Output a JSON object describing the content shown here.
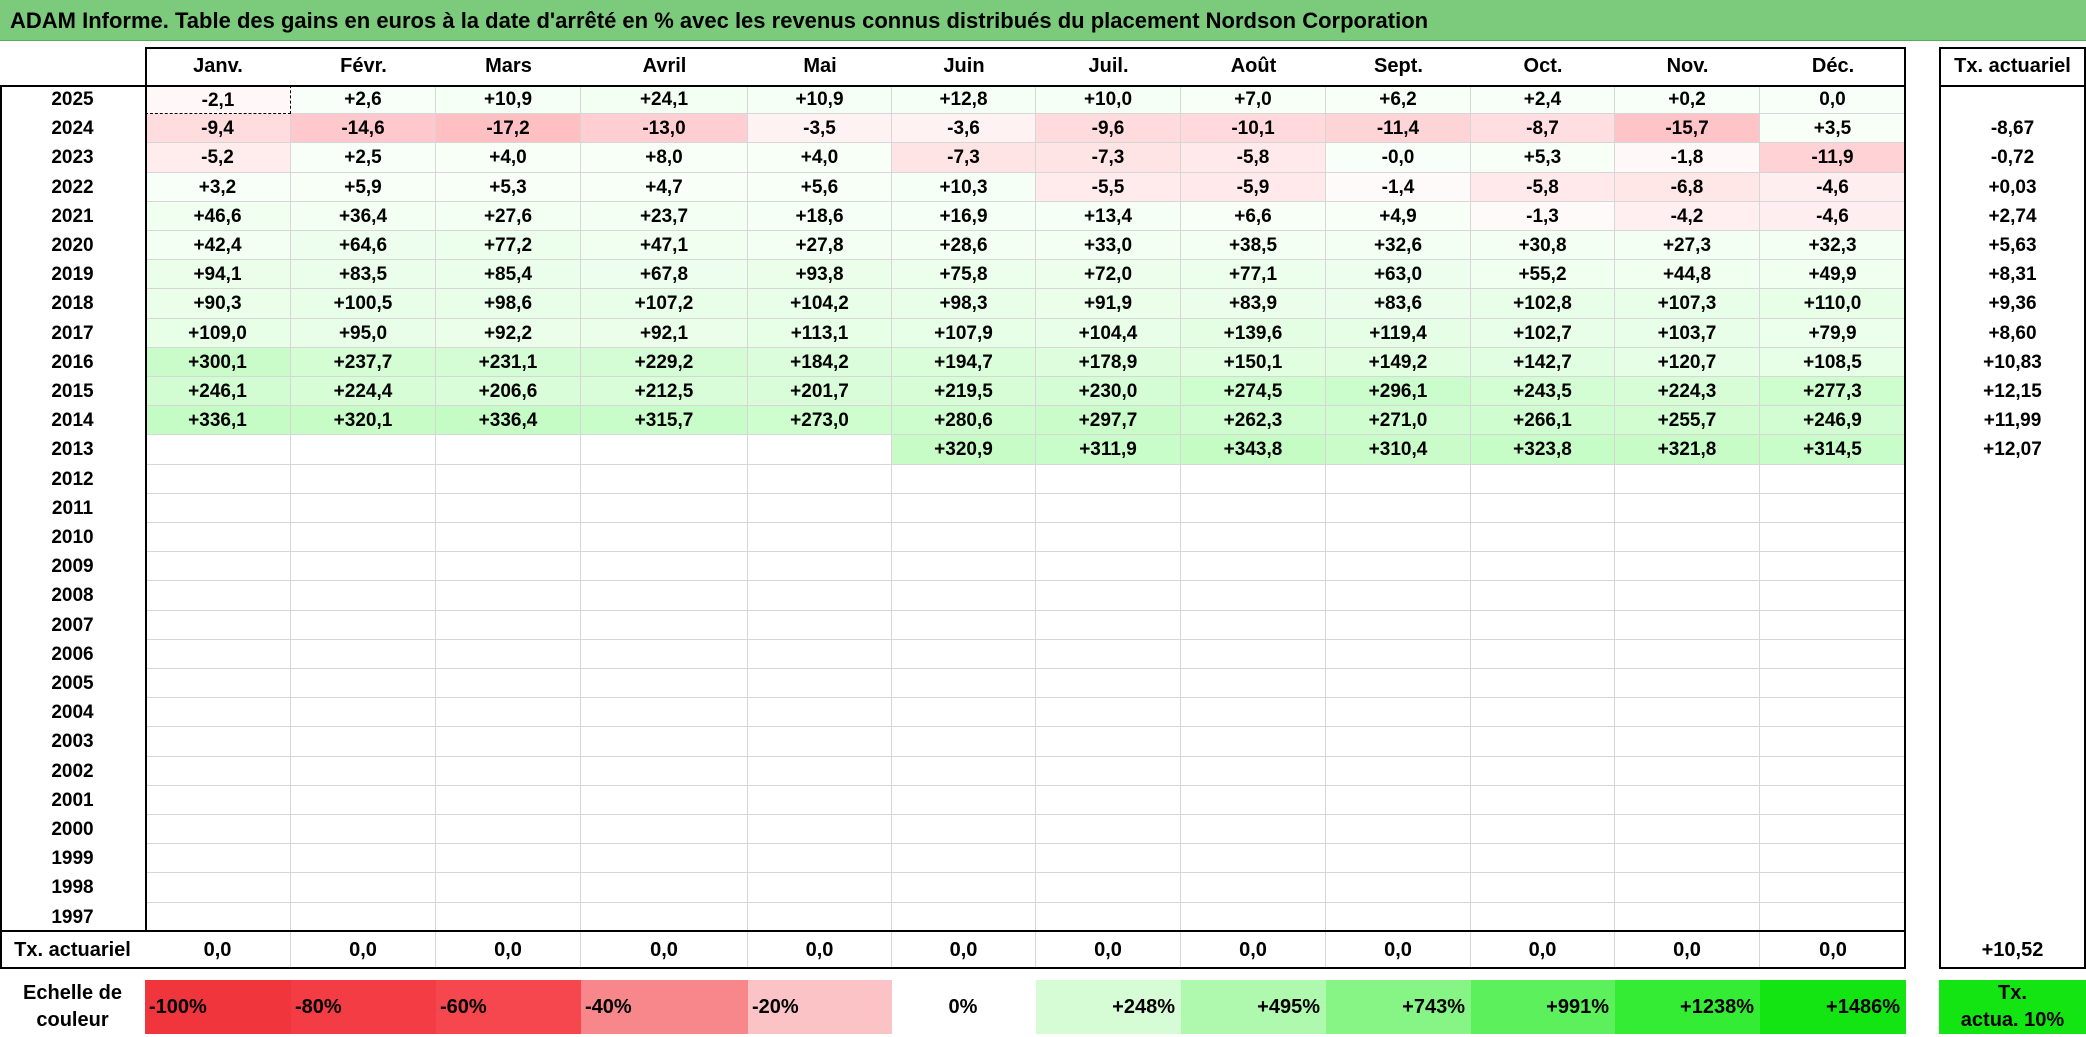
{
  "title": "ADAM Informe. Table des gains en euros à la date d'arrêté en % avec les revenus connus distribués du placement Nordson Corporation",
  "months": [
    "Janv.",
    "Févr.",
    "Mars",
    "Avril",
    "Mai",
    "Juin",
    "Juil.",
    "Août",
    "Sept.",
    "Oct.",
    "Nov.",
    "Déc."
  ],
  "rate_header": "Tx. actuariel",
  "rows": [
    {
      "year": "2025",
      "values": [
        "-2,1",
        "+2,6",
        "+10,9",
        "+24,1",
        "+10,9",
        "+12,8",
        "+10,0",
        "+7,0",
        "+6,2",
        "+2,4",
        "+0,2",
        "0,0"
      ],
      "rate": ""
    },
    {
      "year": "2024",
      "values": [
        "-9,4",
        "-14,6",
        "-17,2",
        "-13,0",
        "-3,5",
        "-3,6",
        "-9,6",
        "-10,1",
        "-11,4",
        "-8,7",
        "-15,7",
        "+3,5"
      ],
      "rate": "-8,67"
    },
    {
      "year": "2023",
      "values": [
        "-5,2",
        "+2,5",
        "+4,0",
        "+8,0",
        "+4,0",
        "-7,3",
        "-7,3",
        "-5,8",
        "-0,0",
        "+5,3",
        "-1,8",
        "-11,9"
      ],
      "rate": "-0,72"
    },
    {
      "year": "2022",
      "values": [
        "+3,2",
        "+5,9",
        "+5,3",
        "+4,7",
        "+5,6",
        "+10,3",
        "-5,5",
        "-5,9",
        "-1,4",
        "-5,8",
        "-6,8",
        "-4,6"
      ],
      "rate": "+0,03"
    },
    {
      "year": "2021",
      "values": [
        "+46,6",
        "+36,4",
        "+27,6",
        "+23,7",
        "+18,6",
        "+16,9",
        "+13,4",
        "+6,6",
        "+4,9",
        "-1,3",
        "-4,2",
        "-4,6"
      ],
      "rate": "+2,74"
    },
    {
      "year": "2020",
      "values": [
        "+42,4",
        "+64,6",
        "+77,2",
        "+47,1",
        "+27,8",
        "+28,6",
        "+33,0",
        "+38,5",
        "+32,6",
        "+30,8",
        "+27,3",
        "+32,3"
      ],
      "rate": "+5,63"
    },
    {
      "year": "2019",
      "values": [
        "+94,1",
        "+83,5",
        "+85,4",
        "+67,8",
        "+93,8",
        "+75,8",
        "+72,0",
        "+77,1",
        "+63,0",
        "+55,2",
        "+44,8",
        "+49,9"
      ],
      "rate": "+8,31"
    },
    {
      "year": "2018",
      "values": [
        "+90,3",
        "+100,5",
        "+98,6",
        "+107,2",
        "+104,2",
        "+98,3",
        "+91,9",
        "+83,9",
        "+83,6",
        "+102,8",
        "+107,3",
        "+110,0"
      ],
      "rate": "+9,36"
    },
    {
      "year": "2017",
      "values": [
        "+109,0",
        "+95,0",
        "+92,2",
        "+92,1",
        "+113,1",
        "+107,9",
        "+104,4",
        "+139,6",
        "+119,4",
        "+102,7",
        "+103,7",
        "+79,9"
      ],
      "rate": "+8,60"
    },
    {
      "year": "2016",
      "values": [
        "+300,1",
        "+237,7",
        "+231,1",
        "+229,2",
        "+184,2",
        "+194,7",
        "+178,9",
        "+150,1",
        "+149,2",
        "+142,7",
        "+120,7",
        "+108,5"
      ],
      "rate": "+10,83"
    },
    {
      "year": "2015",
      "values": [
        "+246,1",
        "+224,4",
        "+206,6",
        "+212,5",
        "+201,7",
        "+219,5",
        "+230,0",
        "+274,5",
        "+296,1",
        "+243,5",
        "+224,3",
        "+277,3"
      ],
      "rate": "+12,15"
    },
    {
      "year": "2014",
      "values": [
        "+336,1",
        "+320,1",
        "+336,4",
        "+315,7",
        "+273,0",
        "+280,6",
        "+297,7",
        "+262,3",
        "+271,0",
        "+266,1",
        "+255,7",
        "+246,9"
      ],
      "rate": "+11,99"
    },
    {
      "year": "2013",
      "values": [
        "",
        "",
        "",
        "",
        "",
        "+320,9",
        "+311,9",
        "+343,8",
        "+310,4",
        "+323,8",
        "+321,8",
        "+314,5"
      ],
      "rate": "+12,07"
    },
    {
      "year": "2012",
      "values": [
        "",
        "",
        "",
        "",
        "",
        "",
        "",
        "",
        "",
        "",
        "",
        ""
      ],
      "rate": ""
    },
    {
      "year": "2011",
      "values": [
        "",
        "",
        "",
        "",
        "",
        "",
        "",
        "",
        "",
        "",
        "",
        ""
      ],
      "rate": ""
    },
    {
      "year": "2010",
      "values": [
        "",
        "",
        "",
        "",
        "",
        "",
        "",
        "",
        "",
        "",
        "",
        ""
      ],
      "rate": ""
    },
    {
      "year": "2009",
      "values": [
        "",
        "",
        "",
        "",
        "",
        "",
        "",
        "",
        "",
        "",
        "",
        ""
      ],
      "rate": ""
    },
    {
      "year": "2008",
      "values": [
        "",
        "",
        "",
        "",
        "",
        "",
        "",
        "",
        "",
        "",
        "",
        ""
      ],
      "rate": ""
    },
    {
      "year": "2007",
      "values": [
        "",
        "",
        "",
        "",
        "",
        "",
        "",
        "",
        "",
        "",
        "",
        ""
      ],
      "rate": ""
    },
    {
      "year": "2006",
      "values": [
        "",
        "",
        "",
        "",
        "",
        "",
        "",
        "",
        "",
        "",
        "",
        ""
      ],
      "rate": ""
    },
    {
      "year": "2005",
      "values": [
        "",
        "",
        "",
        "",
        "",
        "",
        "",
        "",
        "",
        "",
        "",
        ""
      ],
      "rate": ""
    },
    {
      "year": "2004",
      "values": [
        "",
        "",
        "",
        "",
        "",
        "",
        "",
        "",
        "",
        "",
        "",
        ""
      ],
      "rate": ""
    },
    {
      "year": "2003",
      "values": [
        "",
        "",
        "",
        "",
        "",
        "",
        "",
        "",
        "",
        "",
        "",
        ""
      ],
      "rate": ""
    },
    {
      "year": "2002",
      "values": [
        "",
        "",
        "",
        "",
        "",
        "",
        "",
        "",
        "",
        "",
        "",
        ""
      ],
      "rate": ""
    },
    {
      "year": "2001",
      "values": [
        "",
        "",
        "",
        "",
        "",
        "",
        "",
        "",
        "",
        "",
        "",
        ""
      ],
      "rate": ""
    },
    {
      "year": "2000",
      "values": [
        "",
        "",
        "",
        "",
        "",
        "",
        "",
        "",
        "",
        "",
        "",
        ""
      ],
      "rate": ""
    },
    {
      "year": "1999",
      "values": [
        "",
        "",
        "",
        "",
        "",
        "",
        "",
        "",
        "",
        "",
        "",
        ""
      ],
      "rate": ""
    },
    {
      "year": "1998",
      "values": [
        "",
        "",
        "",
        "",
        "",
        "",
        "",
        "",
        "",
        "",
        "",
        ""
      ],
      "rate": ""
    },
    {
      "year": "1997",
      "values": [
        "",
        "",
        "",
        "",
        "",
        "",
        "",
        "",
        "",
        "",
        "",
        ""
      ],
      "rate": ""
    }
  ],
  "footer": {
    "label": "Tx. actuariel",
    "values": [
      "0,0",
      "0,0",
      "0,0",
      "0,0",
      "0,0",
      "0,0",
      "0,0",
      "0,0",
      "0,0",
      "0,0",
      "0,0",
      "0,0"
    ],
    "rate": "+10,52"
  },
  "legend": {
    "label_line1": "Echelle de",
    "label_line2": "couleur",
    "steps": [
      {
        "text": "-100%",
        "color": "#f0353c",
        "align": "left"
      },
      {
        "text": "-80%",
        "color": "#f33c43",
        "align": "left"
      },
      {
        "text": "-60%",
        "color": "#f5474d",
        "align": "left"
      },
      {
        "text": "-40%",
        "color": "#f7878b",
        "align": "left"
      },
      {
        "text": "-20%",
        "color": "#fbc3c5",
        "align": "left"
      },
      {
        "text": "0%",
        "color": "#ffffff",
        "align": "center"
      },
      {
        "text": "+248%",
        "color": "#d6fcd6",
        "align": "right"
      },
      {
        "text": "+495%",
        "color": "#aef9ae",
        "align": "right"
      },
      {
        "text": "+743%",
        "color": "#86f586",
        "align": "right"
      },
      {
        "text": "+991%",
        "color": "#5cf15c",
        "align": "right"
      },
      {
        "text": "+1238%",
        "color": "#33ec33",
        "align": "right"
      },
      {
        "text": "+1486%",
        "color": "#12e512",
        "align": "right"
      }
    ],
    "rate_line1": "Tx.",
    "rate_line2": "actua. 10%",
    "rate_color": "#12e512"
  },
  "colors": {
    "title_bg": "#7ccb7c",
    "neg_max": "#f5474d",
    "pos_max": "#12e512"
  }
}
